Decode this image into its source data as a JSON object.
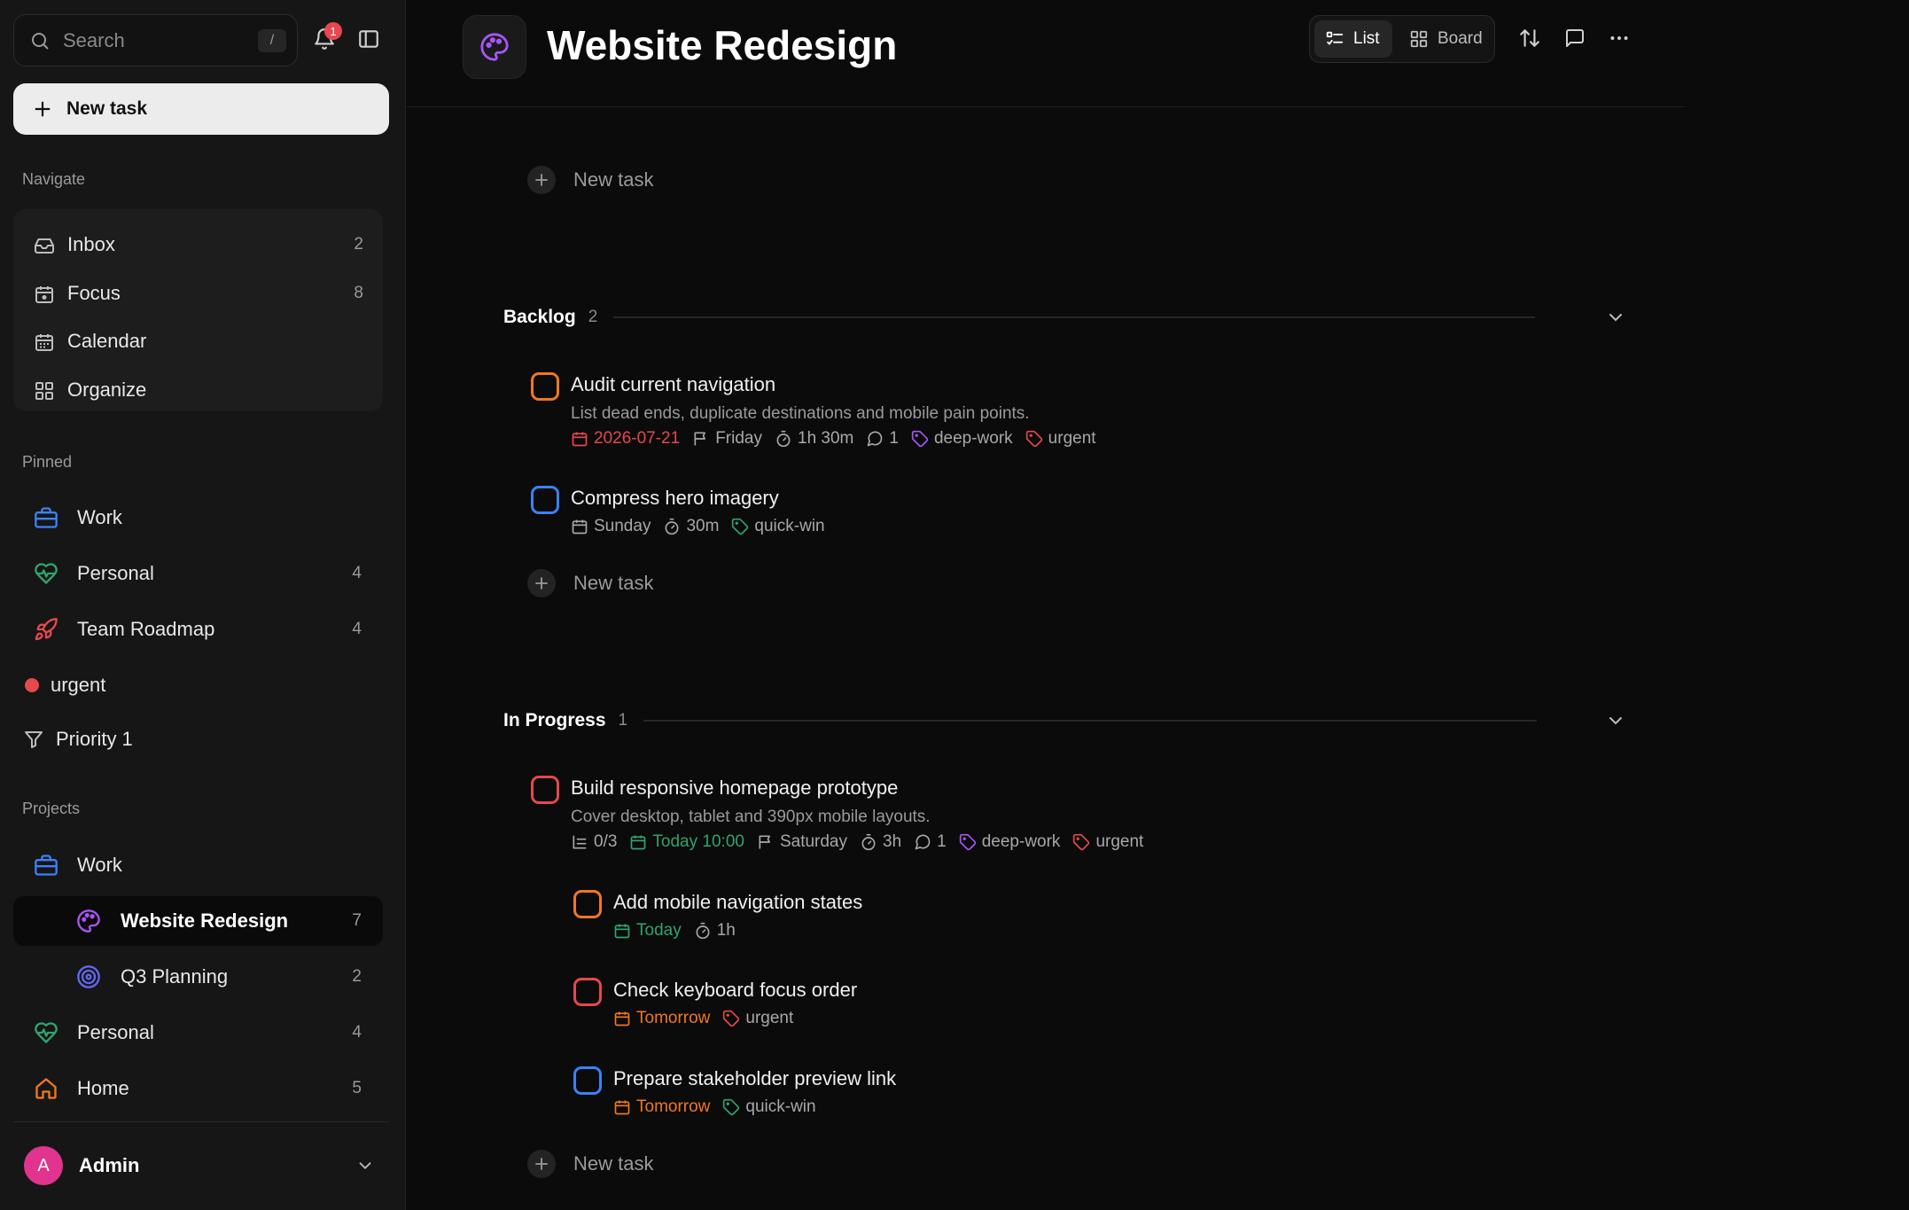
{
  "sidebar": {
    "search_placeholder": "Search",
    "search_shortcut": "/",
    "notification_count": "1",
    "new_task_label": "New task",
    "navigate_label": "Navigate",
    "nav": [
      {
        "label": "Inbox",
        "count": "2"
      },
      {
        "label": "Focus",
        "count": "8"
      },
      {
        "label": "Calendar",
        "count": ""
      },
      {
        "label": "Organize",
        "count": ""
      }
    ],
    "pinned_label": "Pinned",
    "pinned": [
      {
        "label": "Work",
        "count": ""
      },
      {
        "label": "Personal",
        "count": "4"
      },
      {
        "label": "Team Roadmap",
        "count": "4"
      },
      {
        "label": "urgent",
        "count": ""
      },
      {
        "label": "Priority 1",
        "count": ""
      }
    ],
    "projects_label": "Projects",
    "projects": [
      {
        "label": "Work",
        "count": ""
      },
      {
        "label": "Website Redesign",
        "count": "7"
      },
      {
        "label": "Q3 Planning",
        "count": "2"
      },
      {
        "label": "Personal",
        "count": "4"
      },
      {
        "label": "Home",
        "count": "5"
      }
    ],
    "user": {
      "initial": "A",
      "name": "Admin"
    }
  },
  "header": {
    "title": "Website Redesign",
    "view_list": "List",
    "view_board": "Board"
  },
  "add_task_label": "New task",
  "groups": [
    {
      "name": "Backlog",
      "count": "2",
      "tasks": [
        {
          "title": "Audit current navigation",
          "description": "List dead ends, duplicate destinations and mobile pain points.",
          "meta": {
            "date": "2026-07-21",
            "deadline": "Friday",
            "estimate": "1h 30m",
            "comments": "1",
            "tags": [
              "deep-work",
              "urgent"
            ]
          }
        },
        {
          "title": "Compress hero imagery",
          "meta": {
            "date": "Sunday",
            "estimate": "30m",
            "tags": [
              "quick-win"
            ]
          }
        }
      ]
    },
    {
      "name": "In Progress",
      "count": "1",
      "tasks": [
        {
          "title": "Build responsive homepage prototype",
          "description": "Cover desktop, tablet and 390px mobile layouts.",
          "meta": {
            "subtasks": "0/3",
            "date": "Today 10:00",
            "deadline": "Saturday",
            "estimate": "3h",
            "comments": "1",
            "tags": [
              "deep-work",
              "urgent"
            ]
          },
          "subtasks": [
            {
              "title": "Add mobile navigation states",
              "meta": {
                "date": "Today",
                "estimate": "1h"
              }
            },
            {
              "title": "Check keyboard focus order",
              "meta": {
                "date": "Tomorrow",
                "tags": [
                  "urgent"
                ]
              }
            },
            {
              "title": "Prepare stakeholder preview link",
              "meta": {
                "date": "Tomorrow",
                "tags": [
                  "quick-win"
                ]
              }
            }
          ]
        }
      ]
    }
  ],
  "colors": {
    "priority_1": "#e5484d",
    "priority_2": "#f0781f",
    "priority_3": "#3b82f6",
    "tag_deep_work": "#a855f7",
    "tag_urgent": "#e5484d",
    "tag_quick_win": "#30a46c",
    "date_overdue": "#e5484d",
    "date_today": "#30a46c",
    "date_tomorrow": "#f0781f"
  }
}
